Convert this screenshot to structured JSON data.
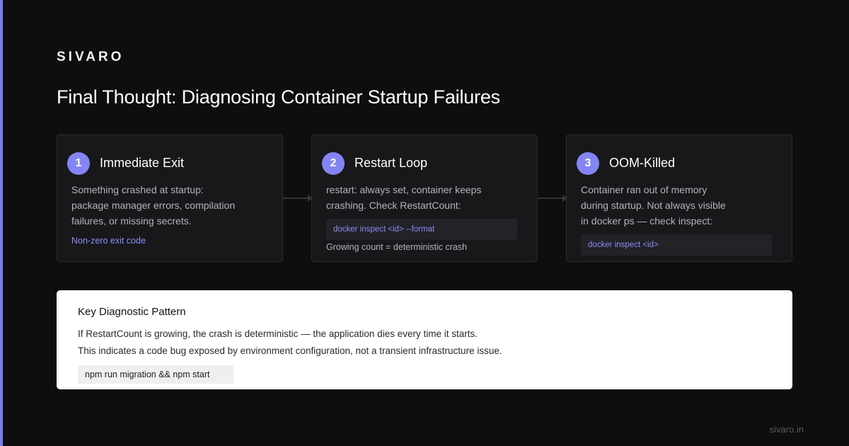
{
  "brand": "SIVARO",
  "title": "Final Thought: Diagnosing Container Startup Failures",
  "cards": [
    {
      "number": "1",
      "title": "Immediate Exit",
      "lines": [
        "Something crashed at startup:",
        "package manager errors, compilation",
        "failures, or missing secrets."
      ],
      "accent": "Non-zero exit code"
    },
    {
      "number": "2",
      "title": "Restart Loop",
      "lines": [
        "restart: always set, container keeps",
        "crashing. Check RestartCount:"
      ],
      "code": "docker inspect <id> --format",
      "note": "Growing count = deterministic crash"
    },
    {
      "number": "3",
      "title": "OOM-Killed",
      "lines": [
        "Container ran out of memory",
        "during startup. Not always visible",
        "in docker ps — check inspect:"
      ],
      "code": "docker inspect <id>"
    }
  ],
  "panel": {
    "title": "Key Diagnostic Pattern",
    "line1": "If RestartCount is growing, the crash is deterministic — the application dies every time it starts.",
    "line2": "This indicates a code bug exposed by environment configuration, not a transient infrastructure issue.",
    "code": "npm run migration && npm start"
  },
  "footer": "sivaro.in",
  "colors": {
    "background": "#0e0e0e",
    "accent": "#7b7ef0",
    "badge": "#8385f4",
    "card": "#18181b",
    "panel": "#ffffff"
  }
}
